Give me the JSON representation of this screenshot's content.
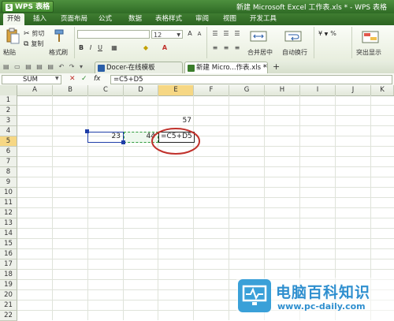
{
  "app": {
    "name": "WPS 表格",
    "logo_letter": "S"
  },
  "window_title": "新建 Microsoft Excel 工作表.xls * - WPS 表格",
  "menu": [
    "开始",
    "插入",
    "页面布局",
    "公式",
    "数据",
    "表格样式",
    "审阅",
    "视图",
    "开发工具"
  ],
  "ribbon": {
    "paste": "粘贴",
    "cut": "剪切",
    "copy": "复制",
    "format_painter": "格式刷",
    "font_size": "12",
    "merge_center": "合并居中",
    "wrap_text": "自动换行",
    "percent": "%",
    "highlight": "突出显示"
  },
  "tabs": [
    {
      "label": "Docer-在线模板",
      "active": false
    },
    {
      "label": "新建 Micro...作表.xls *",
      "active": true
    }
  ],
  "formula_bar": {
    "name_box": "SUM",
    "cancel": "✕",
    "enter": "✓",
    "fx": "fx",
    "content": "=C5+D5"
  },
  "columns": [
    "A",
    "B",
    "C",
    "D",
    "E",
    "F",
    "G",
    "H",
    "I",
    "J",
    "K"
  ],
  "rows": [
    "1",
    "2",
    "3",
    "4",
    "5",
    "6",
    "7",
    "8",
    "9",
    "10",
    "11",
    "12",
    "13",
    "14",
    "15",
    "16",
    "17",
    "18",
    "19",
    "20",
    "21",
    "22"
  ],
  "cells": {
    "E3": "57",
    "C5": "23",
    "D5": "44",
    "E5": "=C5+D5"
  },
  "watermark": {
    "title": "电脑百科知识",
    "url": "www.pc-daily.com"
  },
  "colors": {
    "accent_green": "#3a7d2b",
    "selection_yellow": "#f6d784",
    "annotation_red": "#c0312b",
    "ref_blue": "#1f3ea8",
    "ref_green": "#2f9b3c"
  }
}
